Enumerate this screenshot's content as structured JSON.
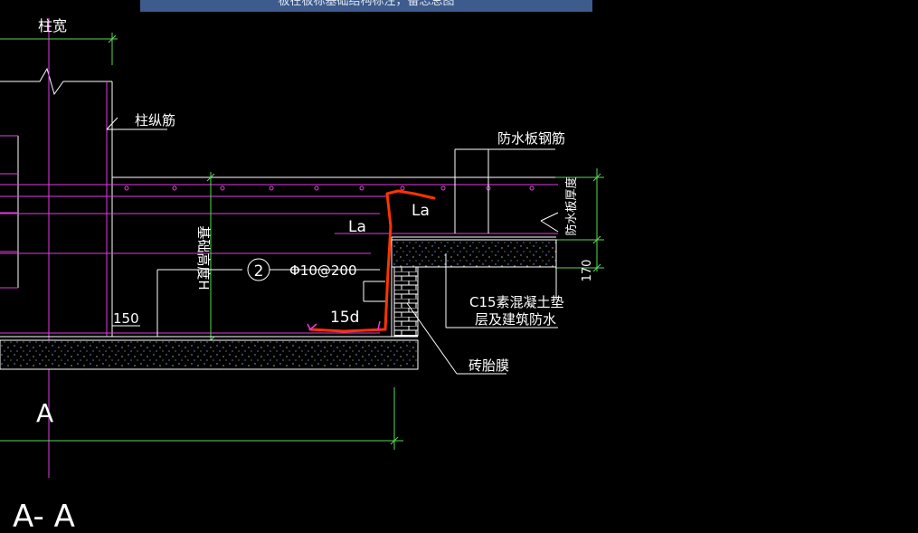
{
  "window": {
    "title": "板在板标基础结构标注，备忘总图"
  },
  "colors": {
    "background": "#000000",
    "line": "#ffffff",
    "magenta": "#e43ce4",
    "dimension": "#59d95a",
    "rebar": "#ff3300",
    "title_bar": "#3d5b8c"
  },
  "labels": {
    "column_width": "柱宽",
    "column_rebar": "柱纵筋",
    "waterproof_rebar": "防水板钢筋",
    "waterproof_thickness": "防水板厚度",
    "la_right": "La",
    "la_left": "La",
    "marker_number": "2",
    "stirrup_spec": "Φ10@200",
    "foundation_height": "基础高度H",
    "dim_150": "150",
    "dim_15d": "15d",
    "concrete_cushion_line1": "C15素混凝土垫",
    "concrete_cushion_line2": "层及建筑防水",
    "dim_170": "170",
    "brick_mould": "砖胎膜",
    "section_mark": "A",
    "section_title": "A- A"
  }
}
